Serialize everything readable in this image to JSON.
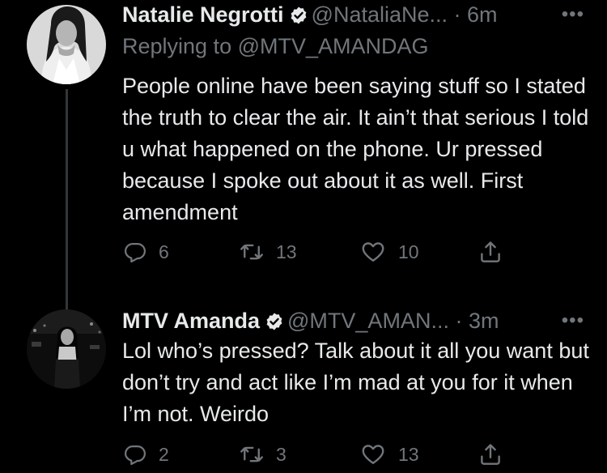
{
  "tweets": [
    {
      "display_name": "Natalie Negrotti",
      "handle": "@NataliaNe...",
      "time": "· 6m",
      "more": "•••",
      "reply_to": "Replying to @MTV_AMANDAG",
      "text": "People online have been saying stuff so I stated the truth to clear the air. It ain’t that serious I told u what happened on the phone. Ur pressed because I spoke out about it as well. First amendment",
      "replies": "6",
      "retweets": "13",
      "likes": "10",
      "icons": {
        "reply": "reply-icon",
        "retweet": "retweet-icon",
        "like": "heart-icon",
        "share": "share-icon",
        "verified": "verified-badge-icon"
      }
    },
    {
      "display_name": "MTV Amanda",
      "handle": "@MTV_AMAN...",
      "time": "· 3m",
      "more": "•••",
      "text": "Lol who’s pressed? Talk about it all you want but don’t try and act like I’m mad at you for it when I’m not. Weirdo",
      "replies": "2",
      "retweets": "3",
      "likes": "13",
      "icons": {
        "reply": "reply-icon",
        "retweet": "retweet-icon",
        "like": "heart-icon",
        "share": "share-icon",
        "verified": "verified-badge-icon"
      }
    }
  ],
  "colors": {
    "background": "#000000",
    "text": "#e7e9ea",
    "muted": "#71767b",
    "thread_line": "#333639"
  }
}
